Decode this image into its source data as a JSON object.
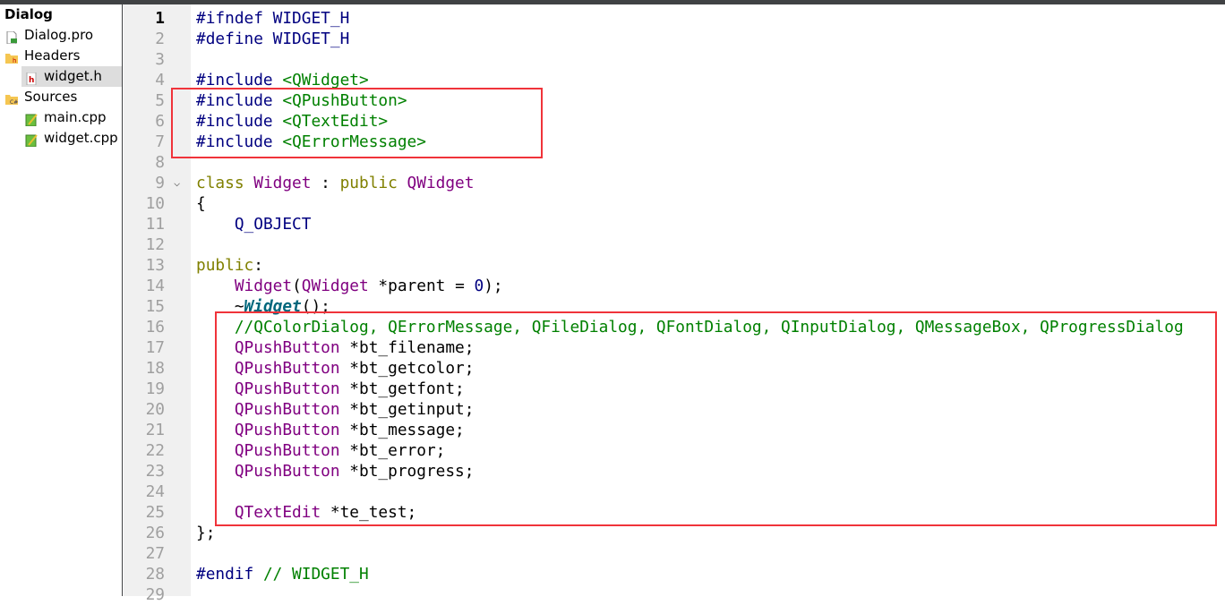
{
  "sidebar": {
    "project": "Dialog",
    "items": [
      {
        "label": "Dialog.pro",
        "icon": "project-file-icon",
        "indent": 1
      },
      {
        "label": "Headers",
        "icon": "headers-folder-icon",
        "indent": 0
      },
      {
        "label": "widget.h",
        "icon": "header-file-icon",
        "indent": 2,
        "selected": true
      },
      {
        "label": "Sources",
        "icon": "sources-folder-icon",
        "indent": 0
      },
      {
        "label": "main.cpp",
        "icon": "cpp-file-icon",
        "indent": 2
      },
      {
        "label": "widget.cpp",
        "icon": "cpp-file-icon",
        "indent": 2
      }
    ]
  },
  "colors": {
    "preproc": "#000080",
    "string": "#008000",
    "keyword": "#808000",
    "type": "#800080",
    "plain": "#000000",
    "comment": "#008000",
    "number": "#000080",
    "decl": "#00677c",
    "highlight": "#f0333a"
  },
  "editor": {
    "current_line": 1,
    "lines": [
      [
        [
          "preproc",
          "#ifndef WIDGET_H"
        ]
      ],
      [
        [
          "preproc",
          "#define WIDGET_H"
        ]
      ],
      [],
      [
        [
          "preproc",
          "#include "
        ],
        [
          "string",
          "<QWidget>"
        ]
      ],
      [
        [
          "preproc",
          "#include "
        ],
        [
          "string",
          "<QPushButton>"
        ]
      ],
      [
        [
          "preproc",
          "#include "
        ],
        [
          "string",
          "<QTextEdit>"
        ]
      ],
      [
        [
          "preproc",
          "#include "
        ],
        [
          "string",
          "<QErrorMessage>"
        ]
      ],
      [],
      [
        [
          "keyword",
          "class "
        ],
        [
          "type",
          "Widget"
        ],
        [
          "plain",
          " : "
        ],
        [
          "keyword",
          "public "
        ],
        [
          "type",
          "QWidget"
        ]
      ],
      [
        [
          "plain",
          "{"
        ]
      ],
      [
        [
          "plain",
          "    "
        ],
        [
          "preproc",
          "Q_OBJECT"
        ]
      ],
      [],
      [
        [
          "keyword",
          "public"
        ],
        [
          "plain",
          ":"
        ]
      ],
      [
        [
          "plain",
          "    "
        ],
        [
          "type",
          "Widget"
        ],
        [
          "plain",
          "("
        ],
        [
          "type",
          "QWidget"
        ],
        [
          "plain",
          " *parent = "
        ],
        [
          "number",
          "0"
        ],
        [
          "plain",
          ");"
        ]
      ],
      [
        [
          "plain",
          "    ~"
        ],
        [
          "decl",
          "Widget"
        ],
        [
          "plain",
          "();"
        ]
      ],
      [
        [
          "plain",
          "    "
        ],
        [
          "comment",
          "//QColorDialog, QErrorMessage, QFileDialog, QFontDialog, QInputDialog, QMessageBox, QProgressDialog"
        ]
      ],
      [
        [
          "plain",
          "    "
        ],
        [
          "type",
          "QPushButton"
        ],
        [
          "plain",
          " *bt_filename;"
        ]
      ],
      [
        [
          "plain",
          "    "
        ],
        [
          "type",
          "QPushButton"
        ],
        [
          "plain",
          " *bt_getcolor;"
        ]
      ],
      [
        [
          "plain",
          "    "
        ],
        [
          "type",
          "QPushButton"
        ],
        [
          "plain",
          " *bt_getfont;"
        ]
      ],
      [
        [
          "plain",
          "    "
        ],
        [
          "type",
          "QPushButton"
        ],
        [
          "plain",
          " *bt_getinput;"
        ]
      ],
      [
        [
          "plain",
          "    "
        ],
        [
          "type",
          "QPushButton"
        ],
        [
          "plain",
          " *bt_message;"
        ]
      ],
      [
        [
          "plain",
          "    "
        ],
        [
          "type",
          "QPushButton"
        ],
        [
          "plain",
          " *bt_error;"
        ]
      ],
      [
        [
          "plain",
          "    "
        ],
        [
          "type",
          "QPushButton"
        ],
        [
          "plain",
          " *bt_progress;"
        ]
      ],
      [],
      [
        [
          "plain",
          "    "
        ],
        [
          "type",
          "QTextEdit"
        ],
        [
          "plain",
          " *te_test;"
        ]
      ],
      [
        [
          "plain",
          "};"
        ]
      ],
      [],
      [
        [
          "preproc",
          "#endif "
        ],
        [
          "comment",
          "// WIDGET_H"
        ]
      ],
      []
    ],
    "foldable_line": 9,
    "fold_icon": "chevron-down-icon"
  }
}
